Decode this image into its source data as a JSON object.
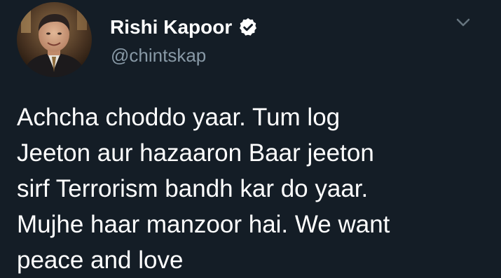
{
  "tweet": {
    "author": {
      "display_name": "Rishi Kapoor",
      "handle": "@chintskap",
      "verified": true,
      "avatar_icon": "profile-photo"
    },
    "menu_icon": "chevron-down-icon",
    "text_lines": [
      "Achcha choddo yaar. Tum log",
      "Jeeton aur hazaaron Baar jeeton",
      "sirf Terrorism bandh kar do yaar.",
      "Mujhe haar manzoor hai. We want",
      "peace and love"
    ]
  },
  "colors": {
    "background": "#141d26",
    "text": "#ffffff",
    "secondary_text": "#8899a6",
    "chevron": "#66757f"
  }
}
